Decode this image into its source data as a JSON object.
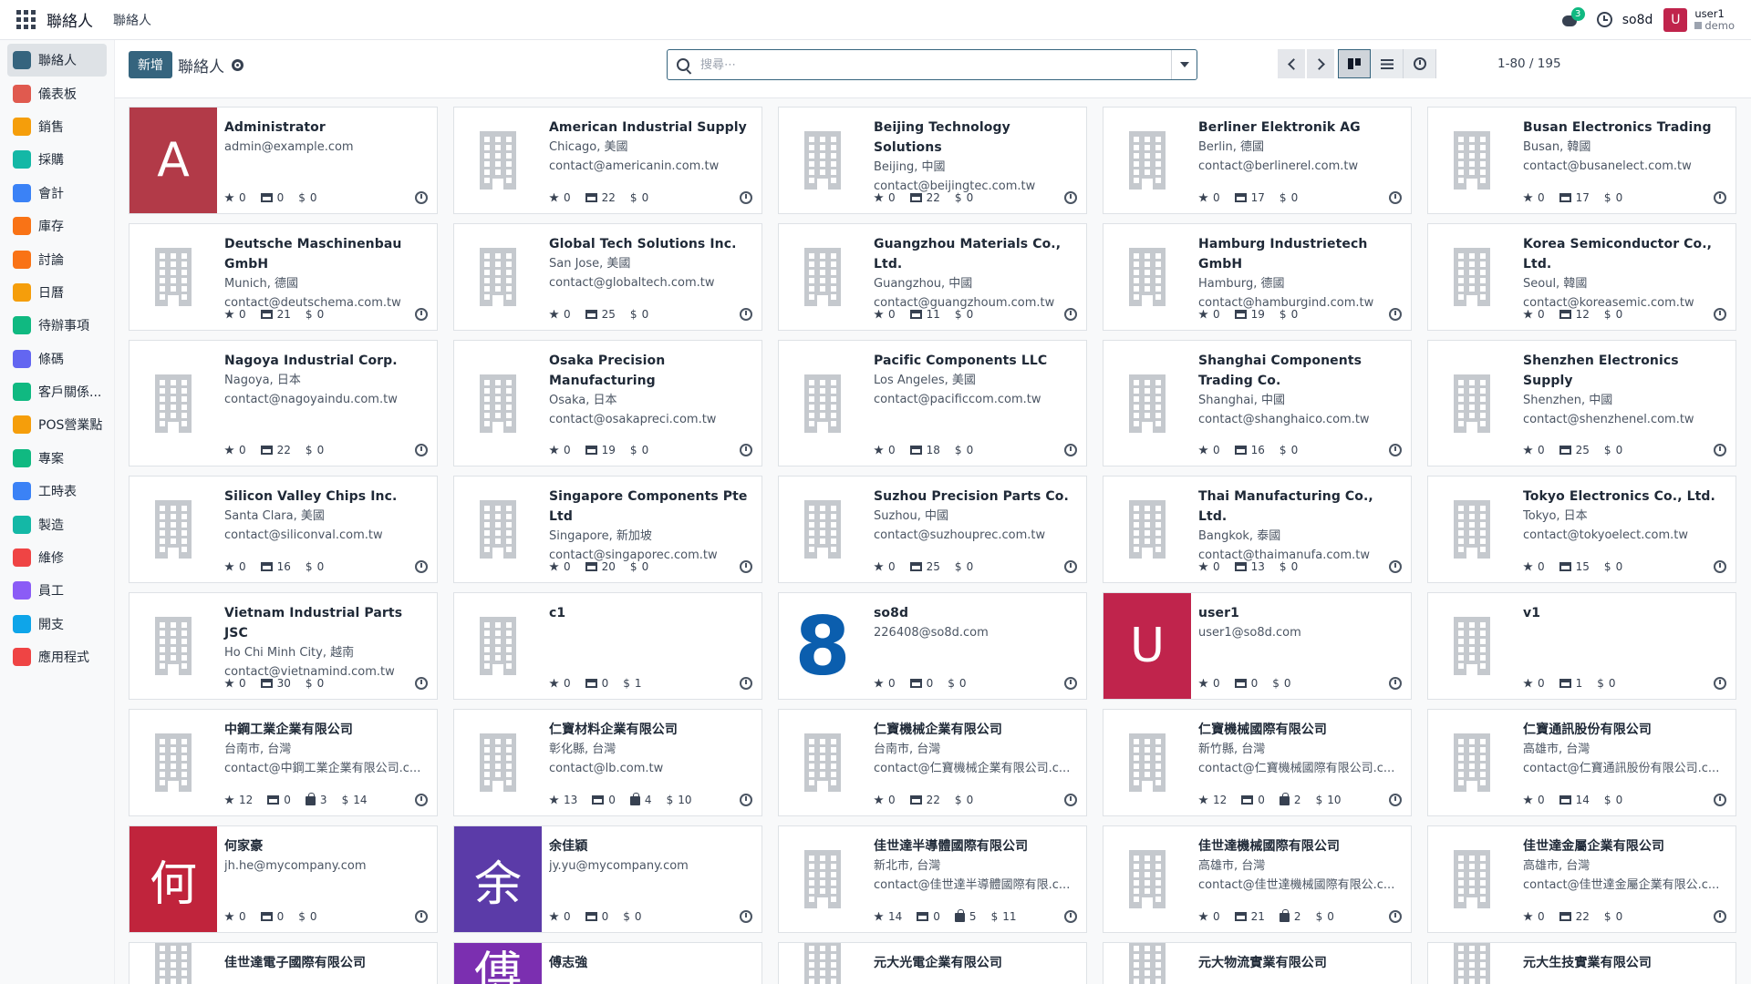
{
  "navbar": {
    "app_title": "聯絡人",
    "menu_item": "聯絡人",
    "chat_badge": "3",
    "company": "so8d",
    "user_avatar_letter": "U",
    "user_name": "user1",
    "database": "demo"
  },
  "sidebar": {
    "items": [
      {
        "label": "聯絡人",
        "icon": "contacts-icon",
        "color": "#35647e",
        "active": true
      },
      {
        "label": "儀表板",
        "icon": "dashboard-icon",
        "color": "#e05a4f"
      },
      {
        "label": "銷售",
        "icon": "sales-icon",
        "color": "#f59e0b"
      },
      {
        "label": "採購",
        "icon": "purchase-icon",
        "color": "#14b8a6"
      },
      {
        "label": "會計",
        "icon": "accounting-icon",
        "color": "#3b82f6"
      },
      {
        "label": "庫存",
        "icon": "inventory-icon",
        "color": "#f97316"
      },
      {
        "label": "討論",
        "icon": "discuss-icon",
        "color": "#f97316"
      },
      {
        "label": "日曆",
        "icon": "calendar-icon",
        "color": "#f59e0b"
      },
      {
        "label": "待辦事項",
        "icon": "todo-icon",
        "color": "#10b981"
      },
      {
        "label": "條碼",
        "icon": "barcode-icon",
        "color": "#6366f1"
      },
      {
        "label": "客戶關係...",
        "icon": "crm-icon",
        "color": "#10b981"
      },
      {
        "label": "POS營業點",
        "icon": "pos-icon",
        "color": "#f59e0b"
      },
      {
        "label": "專案",
        "icon": "project-icon",
        "color": "#10b981"
      },
      {
        "label": "工時表",
        "icon": "timesheet-icon",
        "color": "#3b82f6"
      },
      {
        "label": "製造",
        "icon": "manufacturing-icon",
        "color": "#14b8a6"
      },
      {
        "label": "維修",
        "icon": "repair-icon",
        "color": "#ef4444"
      },
      {
        "label": "員工",
        "icon": "employees-icon",
        "color": "#8b5cf6"
      },
      {
        "label": "開支",
        "icon": "expenses-icon",
        "color": "#0ea5e9"
      },
      {
        "label": "應用程式",
        "icon": "apps-icon",
        "color": "#ef4444"
      }
    ]
  },
  "control": {
    "new_button": "新增",
    "breadcrumb": "聯絡人",
    "search_placeholder": "搜尋⋯",
    "pager": "1-80 / 195"
  },
  "cards": [
    {
      "name": "Administrator",
      "lines": [
        "admin@example.com"
      ],
      "stats": [
        "0",
        "0",
        "0"
      ],
      "avatar": {
        "type": "letter",
        "text": "A",
        "color": "#b23a48"
      }
    },
    {
      "name": "American Industrial Supply",
      "lines": [
        "Chicago, 美國",
        "contact@americanin.com.tw"
      ],
      "stats": [
        "0",
        "22",
        "0"
      ],
      "avatar": {
        "type": "building"
      }
    },
    {
      "name": "Beijing Technology Solutions",
      "lines": [
        "Beijing, 中國",
        "contact@beijingtec.com.tw"
      ],
      "stats": [
        "0",
        "22",
        "0"
      ],
      "avatar": {
        "type": "building"
      }
    },
    {
      "name": "Berliner Elektronik AG",
      "lines": [
        "Berlin, 德國",
        "contact@berlinerel.com.tw"
      ],
      "stats": [
        "0",
        "17",
        "0"
      ],
      "avatar": {
        "type": "building"
      }
    },
    {
      "name": "Busan Electronics Trading",
      "lines": [
        "Busan, 韓國",
        "contact@busanelect.com.tw"
      ],
      "stats": [
        "0",
        "17",
        "0"
      ],
      "avatar": {
        "type": "building"
      }
    },
    {
      "name": "Deutsche Maschinenbau GmbH",
      "lines": [
        "Munich, 德國",
        "contact@deutschema.com.tw"
      ],
      "stats": [
        "0",
        "21",
        "0"
      ],
      "avatar": {
        "type": "building"
      }
    },
    {
      "name": "Global Tech Solutions Inc.",
      "lines": [
        "San Jose, 美國",
        "contact@globaltech.com.tw"
      ],
      "stats": [
        "0",
        "25",
        "0"
      ],
      "avatar": {
        "type": "building"
      }
    },
    {
      "name": "Guangzhou Materials Co., Ltd.",
      "lines": [
        "Guangzhou, 中國",
        "contact@guangzhoum.com.tw"
      ],
      "stats": [
        "0",
        "11",
        "0"
      ],
      "avatar": {
        "type": "building"
      }
    },
    {
      "name": "Hamburg Industrietech GmbH",
      "lines": [
        "Hamburg, 德國",
        "contact@hamburgind.com.tw"
      ],
      "stats": [
        "0",
        "19",
        "0"
      ],
      "avatar": {
        "type": "building"
      }
    },
    {
      "name": "Korea Semiconductor Co., Ltd.",
      "lines": [
        "Seoul, 韓國",
        "contact@koreasemic.com.tw"
      ],
      "stats": [
        "0",
        "12",
        "0"
      ],
      "avatar": {
        "type": "building"
      }
    },
    {
      "name": "Nagoya Industrial Corp.",
      "lines": [
        "Nagoya, 日本",
        "contact@nagoyaindu.com.tw"
      ],
      "stats": [
        "0",
        "22",
        "0"
      ],
      "avatar": {
        "type": "building"
      }
    },
    {
      "name": "Osaka Precision Manufacturing",
      "lines": [
        "Osaka, 日本",
        "contact@osakapreci.com.tw"
      ],
      "stats": [
        "0",
        "19",
        "0"
      ],
      "avatar": {
        "type": "building"
      }
    },
    {
      "name": "Pacific Components LLC",
      "lines": [
        "Los Angeles, 美國",
        "contact@pacificcom.com.tw"
      ],
      "stats": [
        "0",
        "18",
        "0"
      ],
      "avatar": {
        "type": "building"
      }
    },
    {
      "name": "Shanghai Components Trading Co.",
      "lines": [
        "Shanghai, 中國",
        "contact@shanghaico.com.tw"
      ],
      "stats": [
        "0",
        "16",
        "0"
      ],
      "avatar": {
        "type": "building"
      }
    },
    {
      "name": "Shenzhen Electronics Supply",
      "lines": [
        "Shenzhen, 中國",
        "contact@shenzhenel.com.tw"
      ],
      "stats": [
        "0",
        "25",
        "0"
      ],
      "avatar": {
        "type": "building"
      }
    },
    {
      "name": "Silicon Valley Chips Inc.",
      "lines": [
        "Santa Clara, 美國",
        "contact@siliconval.com.tw"
      ],
      "stats": [
        "0",
        "16",
        "0"
      ],
      "avatar": {
        "type": "building"
      }
    },
    {
      "name": "Singapore Components Pte Ltd",
      "lines": [
        "Singapore, 新加坡",
        "contact@singaporec.com.tw"
      ],
      "stats": [
        "0",
        "20",
        "0"
      ],
      "avatar": {
        "type": "building"
      }
    },
    {
      "name": "Suzhou Precision Parts Co.",
      "lines": [
        "Suzhou, 中國",
        "contact@suzhouprec.com.tw"
      ],
      "stats": [
        "0",
        "25",
        "0"
      ],
      "avatar": {
        "type": "building"
      }
    },
    {
      "name": "Thai Manufacturing Co., Ltd.",
      "lines": [
        "Bangkok, 泰國",
        "contact@thaimanufa.com.tw"
      ],
      "stats": [
        "0",
        "13",
        "0"
      ],
      "avatar": {
        "type": "building"
      }
    },
    {
      "name": "Tokyo Electronics Co., Ltd.",
      "lines": [
        "Tokyo, 日本",
        "contact@tokyoelect.com.tw"
      ],
      "stats": [
        "0",
        "15",
        "0"
      ],
      "avatar": {
        "type": "building"
      }
    },
    {
      "name": "Vietnam Industrial Parts JSC",
      "lines": [
        "Ho Chi Minh City, 越南",
        "contact@vietnamind.com.tw"
      ],
      "stats": [
        "0",
        "30",
        "0"
      ],
      "avatar": {
        "type": "building"
      }
    },
    {
      "name": "c1",
      "lines": [],
      "stats": [
        "0",
        "0",
        "1"
      ],
      "avatar": {
        "type": "building"
      }
    },
    {
      "name": "so8d",
      "lines": [
        "226408@so8d.com"
      ],
      "stats": [
        "0",
        "0",
        "0"
      ],
      "avatar": {
        "type": "eight",
        "text": "8"
      }
    },
    {
      "name": "user1",
      "lines": [
        "user1@so8d.com"
      ],
      "stats": [
        "0",
        "0",
        "0"
      ],
      "avatar": {
        "type": "letter",
        "text": "U",
        "color": "#c0244c"
      }
    },
    {
      "name": "v1",
      "lines": [],
      "stats": [
        "0",
        "1",
        "0"
      ],
      "avatar": {
        "type": "building"
      }
    },
    {
      "name": "中鋼工業企業有限公司",
      "lines": [
        "台南市, 台灣",
        "contact@中鋼工業企業有限公司.c..."
      ],
      "stats": [
        "12",
        "0",
        "3",
        "14"
      ],
      "avatar": {
        "type": "building"
      }
    },
    {
      "name": "仁寶材料企業有限公司",
      "lines": [
        "彰化縣, 台灣",
        "contact@lb.com.tw"
      ],
      "stats": [
        "13",
        "0",
        "4",
        "10"
      ],
      "avatar": {
        "type": "building"
      }
    },
    {
      "name": "仁寶機械企業有限公司",
      "lines": [
        "台南市, 台灣",
        "contact@仁寶機械企業有限公司.c..."
      ],
      "stats": [
        "0",
        "22",
        "0"
      ],
      "avatar": {
        "type": "building"
      }
    },
    {
      "name": "仁寶機械國際有限公司",
      "lines": [
        "新竹縣, 台灣",
        "contact@仁寶機械國際有限公司.c..."
      ],
      "stats": [
        "12",
        "0",
        "2",
        "10"
      ],
      "avatar": {
        "type": "building"
      }
    },
    {
      "name": "仁寶通訊股份有限公司",
      "lines": [
        "高雄市, 台灣",
        "contact@仁寶通訊股份有限公司.c..."
      ],
      "stats": [
        "0",
        "14",
        "0"
      ],
      "avatar": {
        "type": "building"
      }
    },
    {
      "name": "何家豪",
      "lines": [
        "jh.he@mycompany.com"
      ],
      "stats": [
        "0",
        "0",
        "0"
      ],
      "avatar": {
        "type": "letter",
        "text": "何",
        "color": "#c0243c"
      }
    },
    {
      "name": "余佳穎",
      "lines": [
        "jy.yu@mycompany.com"
      ],
      "stats": [
        "0",
        "0",
        "0"
      ],
      "avatar": {
        "type": "letter",
        "text": "余",
        "color": "#5b3ba8"
      }
    },
    {
      "name": "佳世達半導體國際有限公司",
      "lines": [
        "新北市, 台灣",
        "contact@佳世達半導體國際有限.c..."
      ],
      "stats": [
        "14",
        "0",
        "5",
        "11"
      ],
      "avatar": {
        "type": "building"
      }
    },
    {
      "name": "佳世達機械國際有限公司",
      "lines": [
        "高雄市, 台灣",
        "contact@佳世達機械國際有限公.c..."
      ],
      "stats": [
        "0",
        "21",
        "2",
        "0"
      ],
      "avatar": {
        "type": "building"
      }
    },
    {
      "name": "佳世達金屬企業有限公司",
      "lines": [
        "高雄市, 台灣",
        "contact@佳世達金屬企業有限公.c..."
      ],
      "stats": [
        "0",
        "22",
        "0"
      ],
      "avatar": {
        "type": "building"
      }
    },
    {
      "name": "佳世達電子國際有限公司",
      "lines": [],
      "stats": [],
      "avatar": {
        "type": "building"
      }
    },
    {
      "name": "傅志強",
      "lines": [],
      "stats": [],
      "avatar": {
        "type": "letter",
        "text": "傅",
        "color": "#7b2fb0"
      }
    },
    {
      "name": "元大光電企業有限公司",
      "lines": [],
      "stats": [],
      "avatar": {
        "type": "building"
      }
    },
    {
      "name": "元大物流實業有限公司",
      "lines": [],
      "stats": [],
      "avatar": {
        "type": "building"
      }
    },
    {
      "name": "元大生技實業有限公司",
      "lines": [],
      "stats": [],
      "avatar": {
        "type": "building"
      }
    }
  ]
}
